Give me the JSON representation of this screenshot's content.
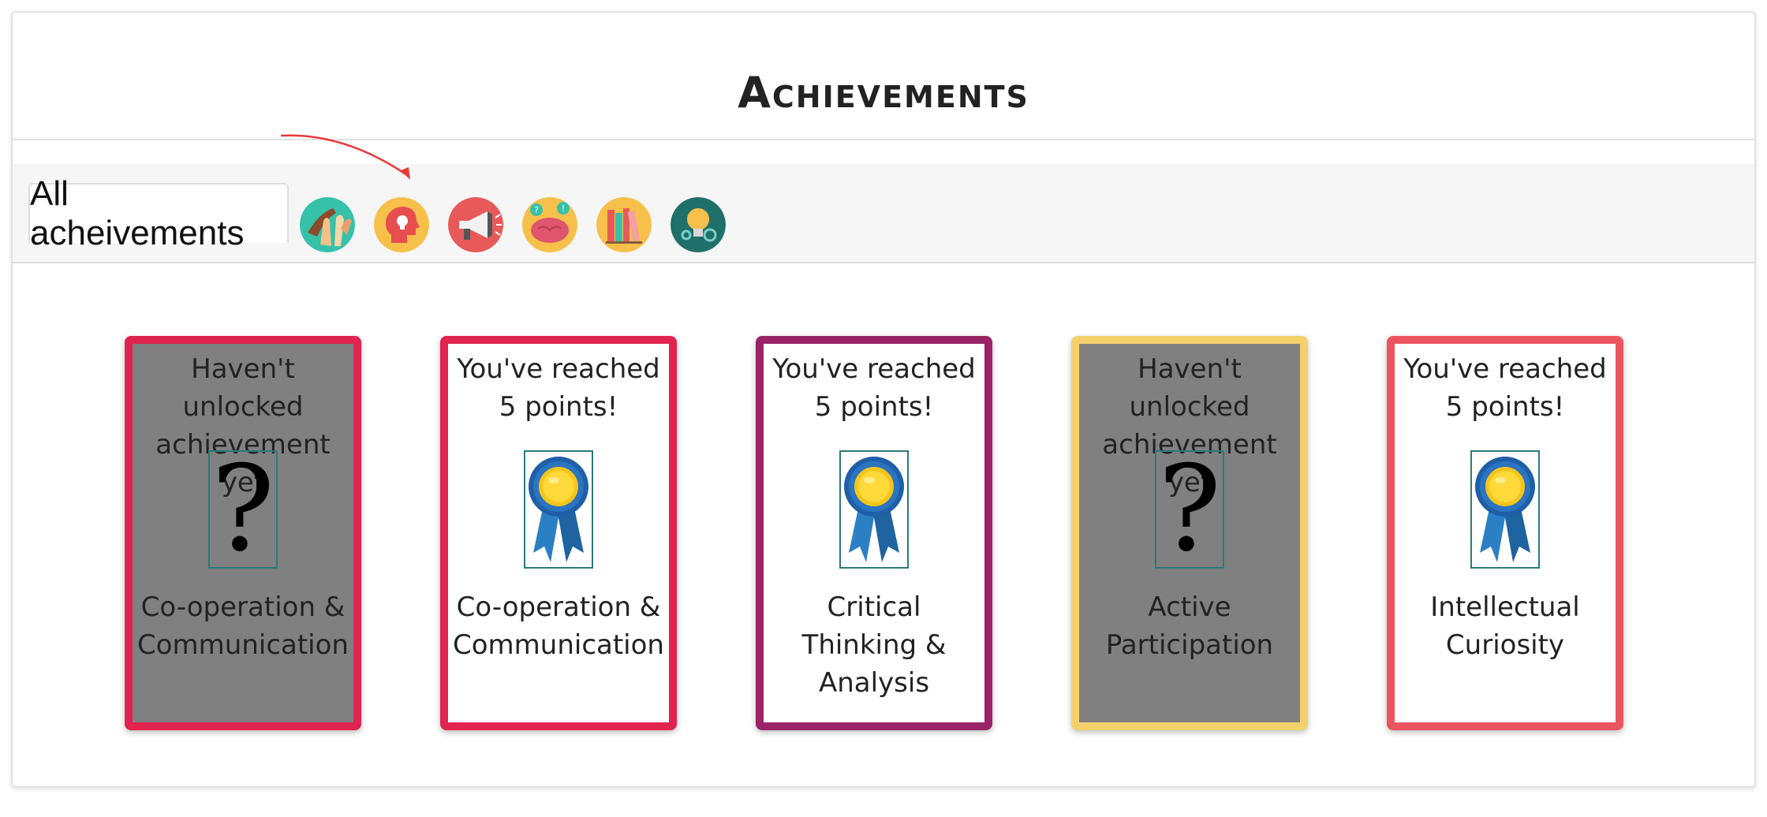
{
  "page": {
    "title": "Achievements"
  },
  "tabs": {
    "all_label": "All acheivements",
    "icons": [
      {
        "name": "cooperation-hands-icon",
        "bg": "#35c2a8"
      },
      {
        "name": "head-lightbulb-icon",
        "bg": "#f7c04a"
      },
      {
        "name": "megaphone-icon",
        "bg": "#e85a5a"
      },
      {
        "name": "brain-question-icon",
        "bg": "#f7c04a"
      },
      {
        "name": "books-icon",
        "bg": "#f7c04a"
      },
      {
        "name": "lightbulb-gear-icon",
        "bg": "#1f6f6a"
      }
    ]
  },
  "cards": [
    {
      "status": "Haven't unlocked achievement yet",
      "name": "Co-operation & Communication",
      "locked": true,
      "border": "#e0234f"
    },
    {
      "status": "You've reached 5 points!",
      "name": "Co-operation & Communication",
      "locked": false,
      "border": "#e0234f"
    },
    {
      "status": "You've reached 5 points!",
      "name": "Critical Thinking & Analysis",
      "locked": false,
      "border": "#9b2468"
    },
    {
      "status": "Haven't unlocked achievement yet",
      "name": "Active Participation",
      "locked": true,
      "border": "#f3d06a"
    },
    {
      "status": "You've reached 5 points!",
      "name": "Intellectual Curiosity",
      "locked": false,
      "border": "#ec5560"
    }
  ],
  "locked_symbol": "?"
}
